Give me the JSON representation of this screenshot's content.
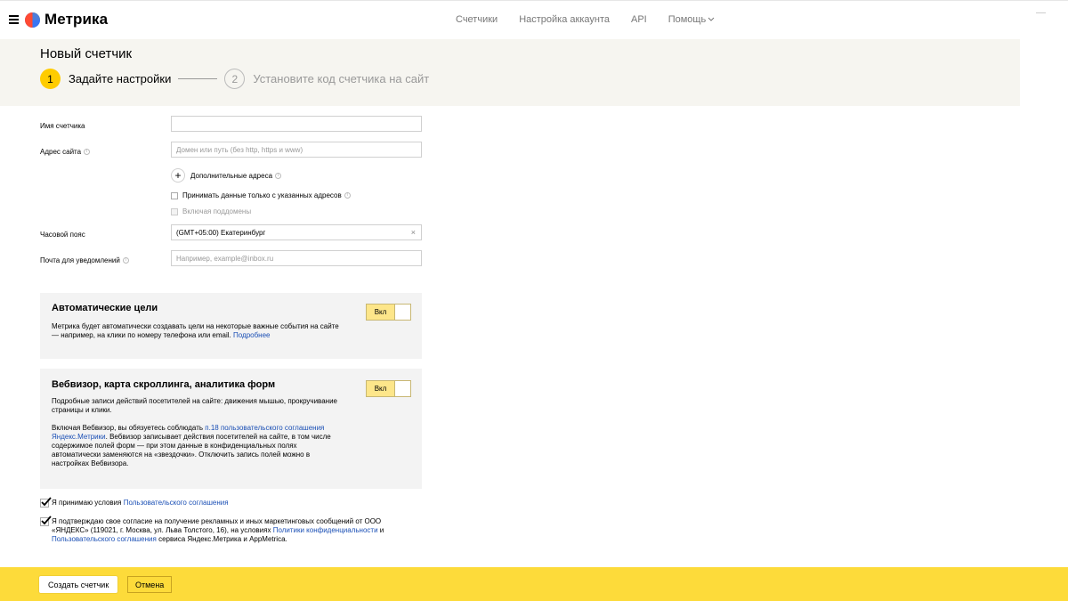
{
  "header": {
    "logo_text": "Метрика",
    "nav": [
      "Счетчики",
      "Настройка аккаунта",
      "API",
      "Помощь"
    ]
  },
  "banner": {
    "title": "Новый счетчик",
    "step1_num": "1",
    "step1_label": "Задайте настройки",
    "step2_num": "2",
    "step2_label": "Установите код счетчика на сайт"
  },
  "form": {
    "name_label": "Имя счетчика",
    "name_value": "",
    "site_label": "Адрес сайта",
    "site_placeholder": "Домен или путь (без http, https и www)",
    "add_addresses": "Дополнительные адреса",
    "only_specified": "Принимать данные только с указанных адресов",
    "include_subdomains": "Включая поддомены",
    "tz_label": "Часовой пояс",
    "tz_value": "(GMT+05:00) Екатеринбург",
    "email_label": "Почта для уведомлений",
    "email_placeholder": "Например, example@inbox.ru"
  },
  "auto_goals": {
    "title": "Автоматические цели",
    "text": "Метрика будет автоматически создавать цели на некоторые важные события на сайте — например, на клики по номеру телефона или email.",
    "link": "Подробнее",
    "toggle_label": "Вкл"
  },
  "webvisor": {
    "title": "Вебвизор, карта скроллинга, аналитика форм",
    "text1": "Подробные записи действий посетителей на сайте: движения мышью, прокручивание страницы и клики.",
    "text2_a": "Включая Вебвизор, вы обязуетесь соблюдать",
    "text2_link": "п.18 пользовательского соглашения Яндекс.Метрики",
    "text2_b": ". Вебвизор записывает действия посетителей на сайте, в том числе содержимое полей форм — при этом данные в конфиденциальных полях автоматически заменяются на «звездочки». Отключить запись полей можно в настройках Вебвизора.",
    "toggle_label": "Вкл"
  },
  "agree1": {
    "text": "Я принимаю условия",
    "link": "Пользовательского соглашения"
  },
  "agree2": {
    "text_a": "Я подтверждаю свое согласие на получение рекламных и иных маркетинговых сообщений от ООО «ЯНДЕКС» (119021, г. Москва, ул. Льва Толстого, 16), на условиях",
    "link1": "Политики конфиденциальности",
    "text_b": "и",
    "link2": "Пользовательского соглашения",
    "text_c": "сервиса Яндекс.Метрика и AppMetrica."
  },
  "bottom_bar": {
    "create_label": "Создать счетчик",
    "cancel_label": "Отмена"
  }
}
